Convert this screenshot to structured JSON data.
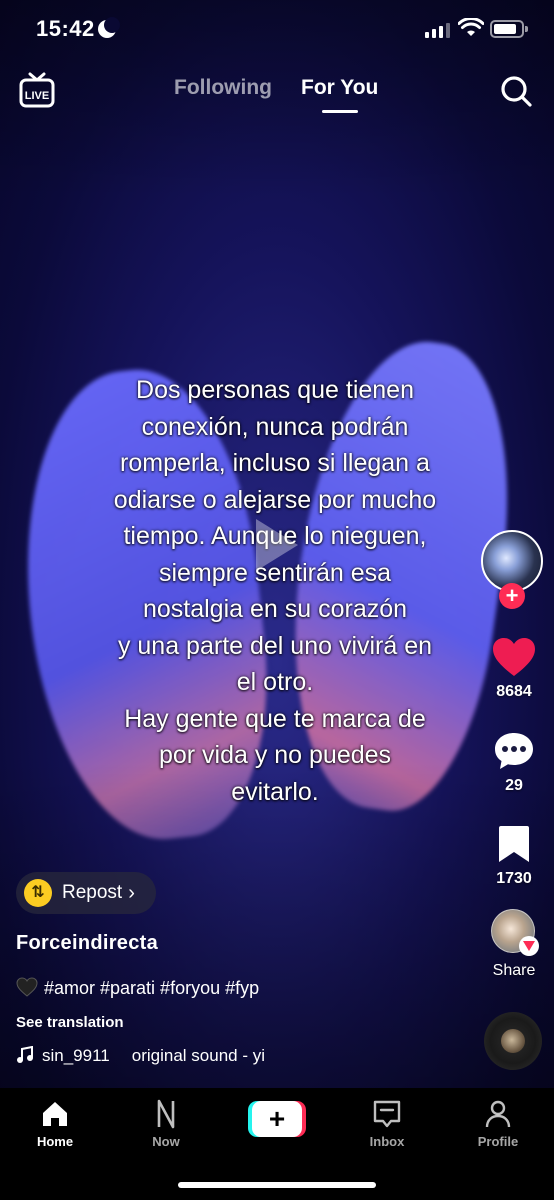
{
  "status_bar": {
    "time": "15:42"
  },
  "top_nav": {
    "tabs": [
      {
        "label": "Following",
        "active": false
      },
      {
        "label": "For You",
        "active": true
      }
    ]
  },
  "video": {
    "overlay_text": "Dos personas que tienen\nconexión, nunca podrán\nromperla, incluso si llegan a\nodiarse o alejarse por mucho\ntiempo. Aunque lo nieguen,\nsiempre sentirán esa\nnostalgia en su corazón\ny una parte del uno vivirá en\nel otro.\nHay gente que te marca de\npor vida y no puedes\nevitarlo."
  },
  "right_rail": {
    "follow_symbol": "+",
    "likes": "8684",
    "comments": "29",
    "saves": "1730",
    "share_label": "Share"
  },
  "post": {
    "repost_label": "Repost",
    "repost_chevron": "›",
    "username": "Forceindirecta",
    "caption": "#amor #parati #foryou #fyp",
    "see_translation": "See translation",
    "sound_user": "sin_9911",
    "sound_name": "original sound - yi"
  },
  "bottom_nav": {
    "items": [
      {
        "label": "Home",
        "active": true
      },
      {
        "label": "Now",
        "active": false
      },
      {
        "label": "+",
        "active": false
      },
      {
        "label": "Inbox",
        "active": false
      },
      {
        "label": "Profile",
        "active": false
      }
    ]
  },
  "colors": {
    "accent_red": "#fe2c55",
    "accent_cyan": "#25f4ee",
    "repost_yellow": "#fccc22",
    "background": "#0b0a3a"
  },
  "icons": [
    "live-icon",
    "search-icon",
    "play-icon",
    "heart-icon",
    "comment-icon",
    "bookmark-icon",
    "share-icon",
    "music-note-icon",
    "home-icon",
    "now-icon",
    "inbox-icon",
    "profile-icon"
  ]
}
